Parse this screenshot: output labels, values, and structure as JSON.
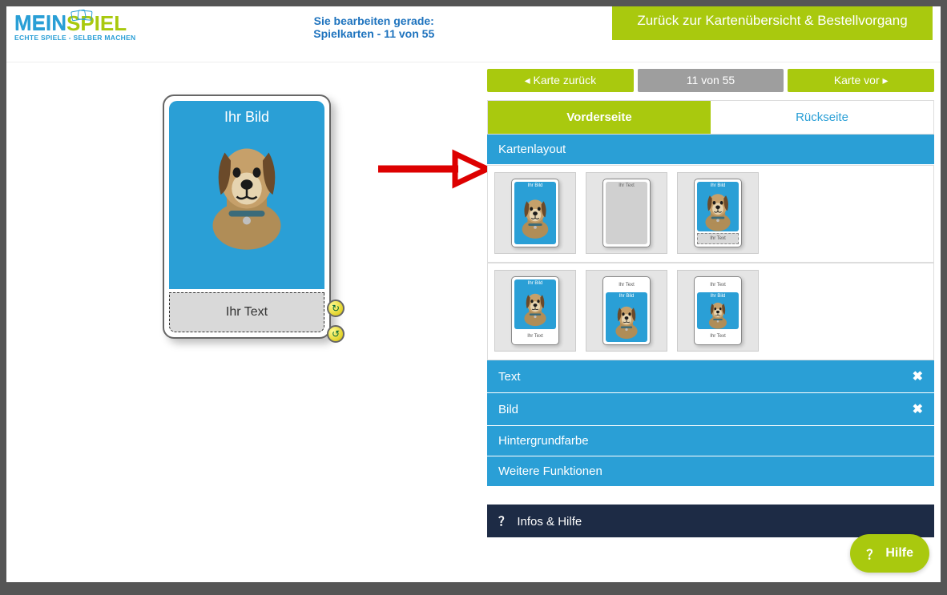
{
  "logo": {
    "mein": "MEIN",
    "spiel": "SPIEL",
    "sub": "ECHTE SPIELE - SELBER MACHEN"
  },
  "header": {
    "mid_line1": "Sie bearbeiten gerade:",
    "mid_line2": "Spielkarten - 11 von 55",
    "right": "Zurück zur Kartenübersicht & Bestellvorgang"
  },
  "nav": {
    "prev": "◂  Karte zurück",
    "counter": "11 von 55",
    "next": "Karte vor  ▸"
  },
  "tabs": {
    "front": "Vorderseite",
    "back": "Rückseite"
  },
  "preview": {
    "image_label": "Ihr Bild",
    "text_label": "Ihr Text"
  },
  "sections": {
    "layout": "Kartenlayout",
    "text": "Text",
    "image": "Bild",
    "bg": "Hintergrundfarbe",
    "more": "Weitere Funktionen",
    "info": "Infos & Hilfe"
  },
  "mini": {
    "bild": "Ihr Bild",
    "text": "Ihr Text"
  },
  "help": "Hilfe"
}
